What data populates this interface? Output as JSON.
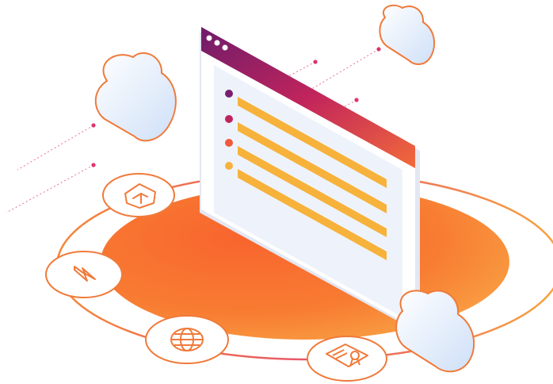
{
  "illustration": {
    "colors": {
      "orange": "#F86A2E",
      "orange_light": "#F9A24A",
      "purple": "#7A1F6E",
      "magenta": "#C0245C",
      "yellow": "#F7B23B",
      "pink_dot": "#E0356A",
      "panel": "#EEF3FB",
      "cloud_fill": "#DCE9FA",
      "cloud_stroke": "#F07A3A"
    },
    "window": {
      "controls": [
        "dot-1",
        "dot-2",
        "dot-3"
      ],
      "list_items": [
        {
          "bullet_color": "#7A1F6E"
        },
        {
          "bullet_color": "#C0245C"
        },
        {
          "bullet_color": "#F05A3A"
        },
        {
          "bullet_color": "#F7B23B"
        }
      ]
    },
    "badges": [
      {
        "icon": "home-shield-icon"
      },
      {
        "icon": "lightning-icon"
      },
      {
        "icon": "globe-icon"
      },
      {
        "icon": "certificate-icon"
      }
    ],
    "clouds": [
      "cloud-left",
      "cloud-top-right",
      "cloud-bottom-right"
    ]
  }
}
